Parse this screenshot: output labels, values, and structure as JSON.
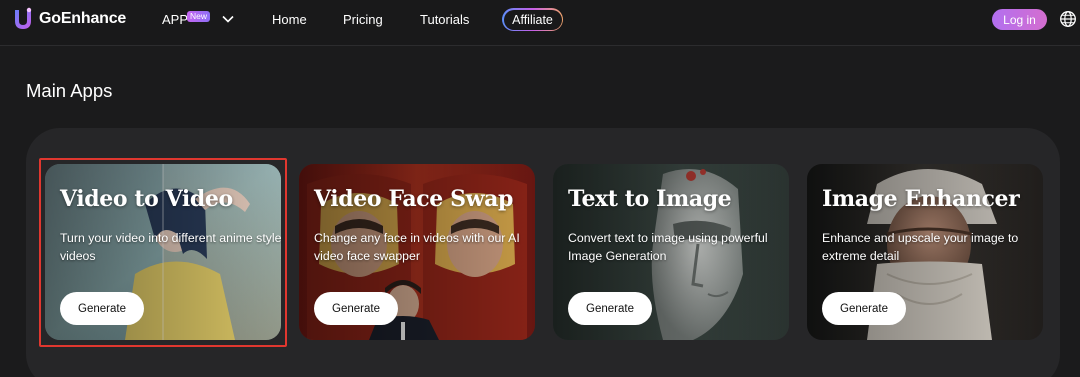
{
  "brand": {
    "name": "GoEnhance",
    "icon": "goenhance-logo"
  },
  "nav": {
    "app_label": "APP",
    "app_badge": "New",
    "items": [
      "Home",
      "Pricing",
      "Tutorials"
    ],
    "affiliate_label": "Affiliate",
    "login_label": "Log in",
    "language_icon": "globe-icon"
  },
  "colors": {
    "highlight_border": "#e0372f",
    "login_gradient": "#b26ff0",
    "badge_gradient": "#c567f2"
  },
  "section": {
    "title": "Main Apps"
  },
  "cards": [
    {
      "title": "Video to Video",
      "description": "Turn your video into different anime style videos",
      "button": "Generate",
      "selected": true
    },
    {
      "title": "Video Face Swap",
      "description": "Change any face in videos with our AI video face swapper",
      "button": "Generate",
      "selected": false
    },
    {
      "title": "Text to Image",
      "description": "Convert text to image using powerful Image Generation",
      "button": "Generate",
      "selected": false
    },
    {
      "title": "Image Enhancer",
      "description": "Enhance and upscale your image to extreme detail",
      "button": "Generate",
      "selected": false
    }
  ]
}
